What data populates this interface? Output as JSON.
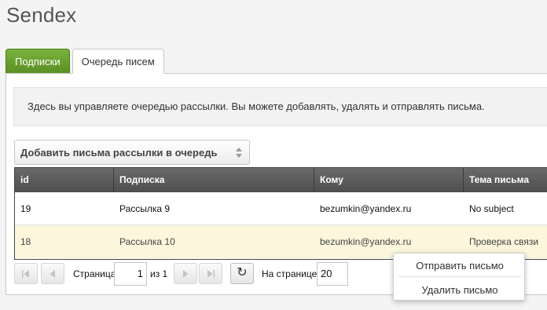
{
  "app": {
    "title": "Sendex"
  },
  "tabs": [
    {
      "label": "Подписки",
      "active": true
    },
    {
      "label": "Очередь писем",
      "active": false
    }
  ],
  "info": {
    "text": "Здесь вы управляете очередью рассылки. Вы можете добавлять, удалять и отправлять письма."
  },
  "queue_select": {
    "label": "Добавить письма рассылки в очередь"
  },
  "grid": {
    "columns": [
      "id",
      "Подписка",
      "Кому",
      "Тема письма"
    ],
    "rows": [
      {
        "id": "19",
        "subscription": "Рассылка 9",
        "to": "bezumkin@yandex.ru",
        "subject": "No subject"
      },
      {
        "id": "18",
        "subscription": "Рассылка 10",
        "to": "bezumkin@yandex.ru",
        "subject": "Проверка связи"
      }
    ]
  },
  "pager": {
    "page_label": "Страница",
    "page_value": "1",
    "of_label": "из 1",
    "per_page_label": "На странице:",
    "per_page_value": "20"
  },
  "context_menu": {
    "items": [
      "Отправить письмо",
      "Удалить письмо"
    ]
  },
  "colors": {
    "active_tab": "#6aa132",
    "selected_row": "#fbf6dc",
    "grid_header": "#555555"
  }
}
